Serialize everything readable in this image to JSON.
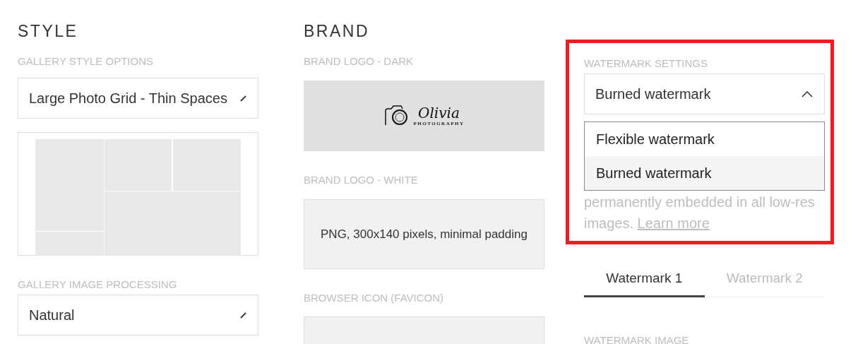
{
  "style": {
    "heading": "STYLE",
    "gallery_style": {
      "label": "GALLERY STYLE OPTIONS",
      "value": "Large Photo Grid - Thin Spaces"
    },
    "image_processing": {
      "label": "GALLERY IMAGE PROCESSING",
      "value": "Natural"
    }
  },
  "brand": {
    "heading": "BRAND",
    "logo_dark": {
      "label": "BRAND LOGO - DARK",
      "logo_text": "Olivia",
      "logo_subtext": "PHOTOGRAPHY"
    },
    "logo_white": {
      "label": "BRAND LOGO - WHITE",
      "hint": "PNG, 300x140 pixels, minimal padding"
    },
    "favicon": {
      "label": "BROWSER ICON (FAVICON)"
    }
  },
  "watermark": {
    "label": "WATERMARK SETTINGS",
    "value": "Burned watermark",
    "expanded": true,
    "options": [
      {
        "label": "Flexible watermark",
        "selected": false
      },
      {
        "label": "Burned watermark",
        "selected": true
      }
    ],
    "description": "permanently embedded in all low-res images.",
    "link": "Learn more",
    "tabs": [
      {
        "label": "Watermark 1",
        "selected": true
      },
      {
        "label": "Watermark 2",
        "selected": false
      }
    ],
    "next_label": "WATERMARK IMAGE"
  }
}
